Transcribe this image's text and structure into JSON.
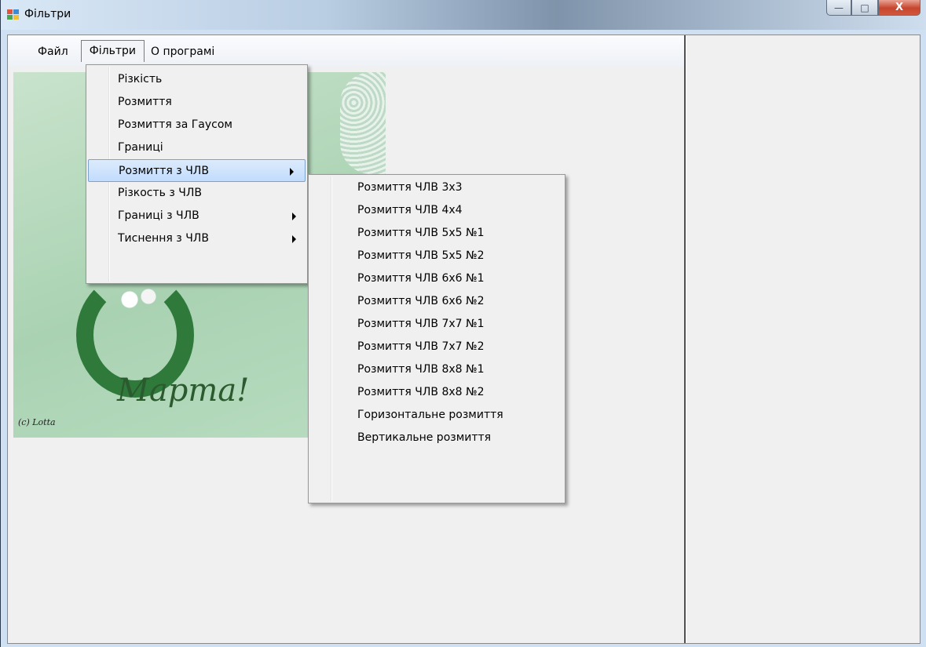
{
  "window": {
    "title": "Фільтри",
    "buttons": {
      "minimize": "—",
      "maximize": "□",
      "close": "X"
    }
  },
  "menubar": {
    "items": [
      "Файл",
      "Фільтри",
      "О програмі"
    ]
  },
  "filters_menu": {
    "items": [
      {
        "label": "Різкість",
        "submenu": false
      },
      {
        "label": "Розмиття",
        "submenu": false
      },
      {
        "label": "Розмиття за Гаусом",
        "submenu": false
      },
      {
        "label": "Границі",
        "submenu": false
      },
      {
        "label": "Розмиття з ЧЛВ",
        "submenu": true,
        "selected": true
      },
      {
        "label": "Різкость з ЧЛВ",
        "submenu": false
      },
      {
        "label": "Границі з ЧЛВ",
        "submenu": true
      },
      {
        "label": "Тиснення з ЧЛВ",
        "submenu": true
      }
    ]
  },
  "blur_submenu": {
    "items": [
      "Розмиття ЧЛВ 3x3",
      "Розмиття ЧЛВ 4x4",
      "Розмиття ЧЛВ 5x5 №1",
      "Розмиття ЧЛВ 5x5 №2",
      "Розмиття ЧЛВ 6x6 №1",
      "Розмиття ЧЛВ 6x6 №2",
      "Розмиття ЧЛВ 7x7 №1",
      "Розмиття ЧЛВ 7x7 №2",
      "Розмиття ЧЛВ 8x8 №1",
      "Розмиття ЧЛВ 8x8 №2",
      "Горизонтальне розмиття",
      "Вертикальне розмиття"
    ]
  },
  "picture": {
    "caption": "Марта!",
    "copyright": "(c) Lotta"
  },
  "colors": {
    "menu_highlight": "#c2dcfd",
    "menu_background": "#f0f0f0",
    "picture_green": "#a9d2b2"
  }
}
